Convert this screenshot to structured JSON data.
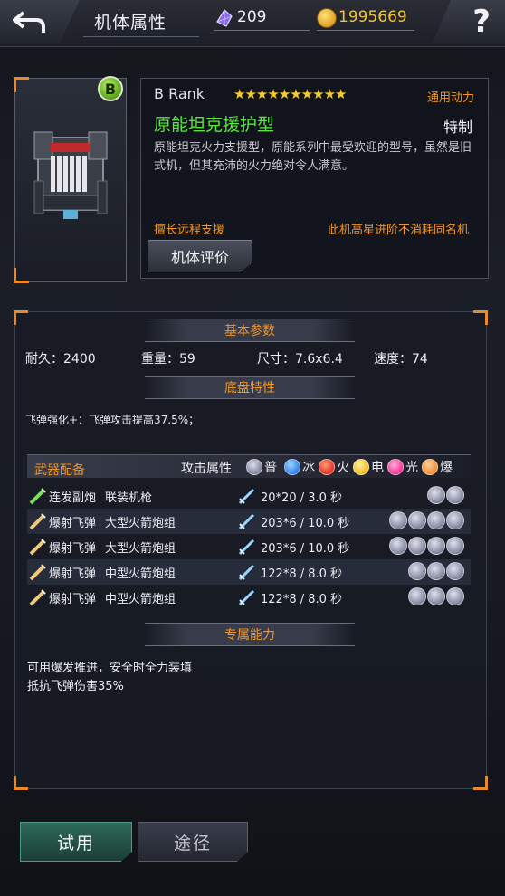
{
  "header": {
    "title": "机体属性",
    "gems": "209",
    "coins": "1995669",
    "help_label": "?"
  },
  "mech": {
    "rank_badge": "B",
    "rank_text": "B  Rank",
    "stars": "★★★★★★★★★★",
    "power_tag": "通用动力",
    "name": "原能坦克援护型",
    "special_tag": "特制",
    "description": "原能坦克火力支援型，原能系列中最受欢迎的型号，虽然是旧式机，但其充沛的火力绝对令人满意。",
    "trait_left": "擅长远程支援",
    "trait_right": "此机高星进阶不消耗同名机",
    "eval_label": "机体评价"
  },
  "basic": {
    "heading": "基本参数",
    "durability": "耐久：2400",
    "weight": "重量：59",
    "size": "尺寸：7.6x6.4",
    "speed": "速度：74"
  },
  "chassis": {
    "heading": "底盘特性",
    "line": "飞弹强化+：飞弹攻击提高37.5%；"
  },
  "weapons": {
    "heading": "武器配备",
    "attr_label": "攻击属性",
    "legend": [
      {
        "icon": "normal-orb-icon",
        "label": "普"
      },
      {
        "icon": "ice-orb-icon",
        "label": "冰"
      },
      {
        "icon": "fire-orb-icon",
        "label": "火"
      },
      {
        "icon": "electric-orb-icon",
        "label": "电"
      },
      {
        "icon": "light-orb-icon",
        "label": "光"
      },
      {
        "icon": "blast-orb-icon",
        "label": "爆"
      }
    ],
    "rows": [
      {
        "type": "连发副炮",
        "name": "联装机枪",
        "damage": "20*20 / 3.0 秒",
        "orbs": 2
      },
      {
        "type": "爆射飞弹",
        "name": "大型火箭炮组",
        "damage": "203*6 / 10.0 秒",
        "orbs": 4
      },
      {
        "type": "爆射飞弹",
        "name": "大型火箭炮组",
        "damage": "203*6 / 10.0 秒",
        "orbs": 4
      },
      {
        "type": "爆射飞弹",
        "name": "中型火箭炮组",
        "damage": "122*8 / 8.0 秒",
        "orbs": 3
      },
      {
        "type": "爆射飞弹",
        "name": "中型火箭炮组",
        "damage": "122*8 / 8.0 秒",
        "orbs": 3
      }
    ]
  },
  "exclusive": {
    "heading": "专属能力",
    "lines": [
      "可用爆发推进，安全时全力装填",
      "抵抗飞弹伤害35%"
    ]
  },
  "buttons": {
    "try": "试用",
    "path": "途径"
  },
  "colors": {
    "accent_orange": "#f0962a",
    "name_green": "#58e83a",
    "star_gold": "#f6c832",
    "coin_gold": "#f0c43a"
  }
}
